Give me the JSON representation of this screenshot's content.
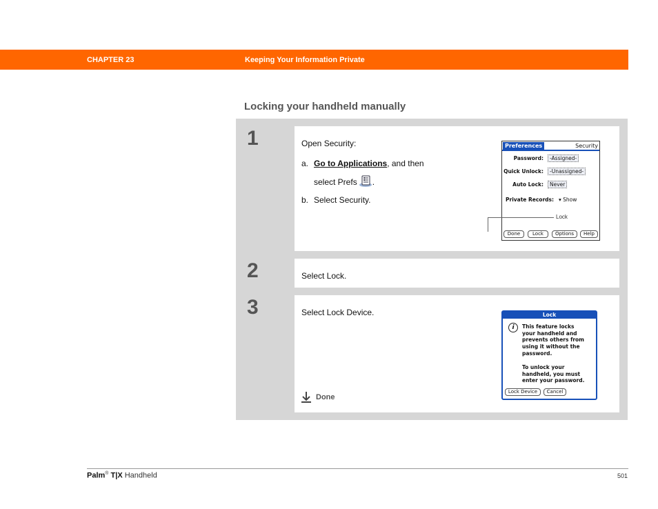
{
  "header": {
    "chapter": "CHAPTER 23",
    "title": "Keeping Your Information Private"
  },
  "section_heading": "Locking your handheld manually",
  "steps": [
    {
      "number": "1",
      "intro": "Open Security:",
      "a_prefix": "a.",
      "a_link": "Go to Applications",
      "a_suffix": ", and then",
      "a_line2": "select Prefs",
      "a_end": ".",
      "b_prefix": "b.",
      "b_text": "Select Security.",
      "screen": {
        "tab": "Preferences",
        "title": "Security",
        "password_label": "Password:",
        "password_value": "-Assigned-",
        "quick_unlock_label": "Quick Unlock:",
        "quick_unlock_value": "-Unassigned-",
        "auto_lock_label": "Auto Lock:",
        "auto_lock_value": "Never",
        "private_records_label": "Private Records:",
        "private_records_value": "Show",
        "buttons": [
          "Done",
          "Lock",
          "Options",
          "Help"
        ],
        "callout": "Lock"
      }
    },
    {
      "number": "2",
      "text": "Select Lock."
    },
    {
      "number": "3",
      "text": "Select Lock Device.",
      "done": "Done",
      "dialog": {
        "title": "Lock",
        "message1": "This feature locks\nyour handheld and\nprevents others from\nusing it without the\npassword.",
        "message2": "To unlock your\nhandheld, you must\nenter your password.",
        "lock_device": "Lock Device",
        "cancel": "Cancel"
      }
    }
  ],
  "footer": {
    "brand": "Palm",
    "reg": "®",
    "model": "T|X",
    "product": "Handheld",
    "page": "501"
  }
}
